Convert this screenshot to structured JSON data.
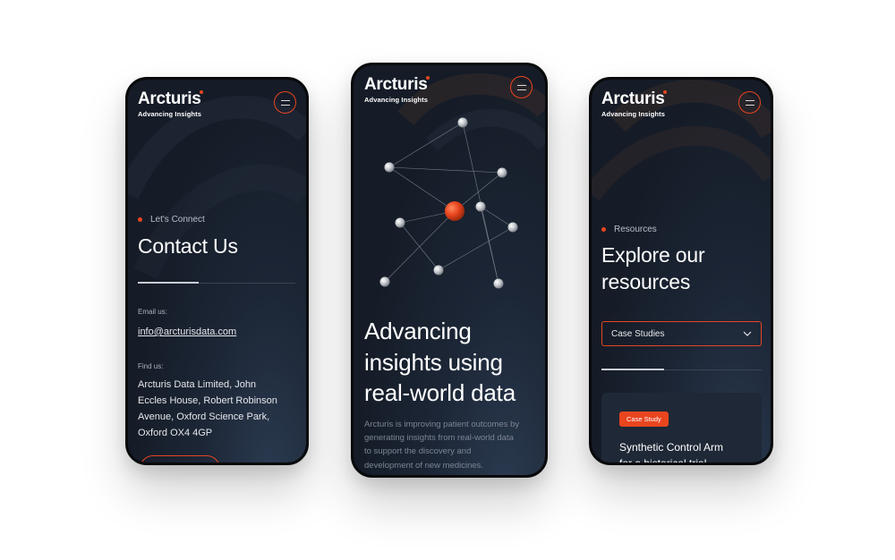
{
  "brand": {
    "name": "Arcturis",
    "tagline": "Advancing Insights",
    "accent": "#e9451f"
  },
  "contact_screen": {
    "eyebrow": "Let's Connect",
    "title": "Contact Us",
    "email_label": "Email us:",
    "email": "info@arcturisdata.com",
    "address_label": "Find us:",
    "address_lines": [
      "Arcturis Data Limited, John",
      "Eccles House, Robert Robinson",
      "Avenue, Oxford Science Park,",
      "Oxford OX4 4GP"
    ]
  },
  "home_screen": {
    "headline_lines": [
      "Advancing",
      "insights using",
      "real-world data"
    ],
    "intro_lines": [
      "Arcturis is improving patient outcomes by",
      "generating insights from real-world data",
      "to support the discovery and",
      "development of new medicines."
    ]
  },
  "resources_screen": {
    "eyebrow": "Resources",
    "title_lines": [
      "Explore our",
      "resources"
    ],
    "filter": {
      "selected": "Case Studies",
      "icon": "chevron-down-icon"
    },
    "card": {
      "badge": "Case Study",
      "title_lines": [
        "Synthetic Control Arm",
        "for a historical trial"
      ]
    }
  }
}
